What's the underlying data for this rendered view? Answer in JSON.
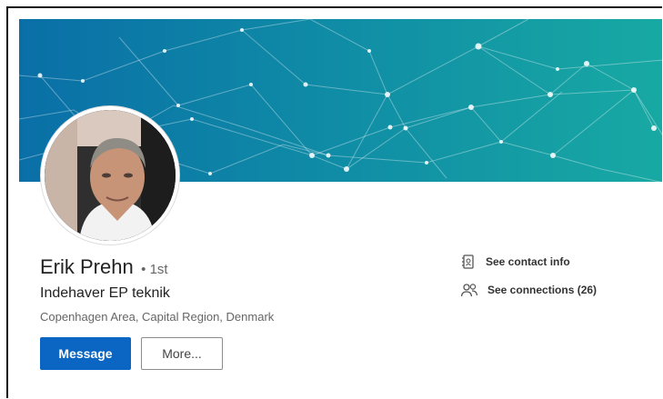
{
  "profile": {
    "name": "Erik Prehn",
    "degree": "• 1st",
    "headline": "Indehaver EP teknik",
    "location": "Copenhagen Area, Capital Region, Denmark"
  },
  "actions": {
    "message_label": "Message",
    "more_label": "More..."
  },
  "links": {
    "contact_info": "See contact info",
    "connections": "See connections (26)"
  },
  "icons": {
    "contact": "contact-card-icon",
    "connections": "people-icon"
  },
  "colors": {
    "primary_button": "#0a66c2",
    "banner_start": "#0a6fa7",
    "banner_end": "#18a9a3"
  }
}
